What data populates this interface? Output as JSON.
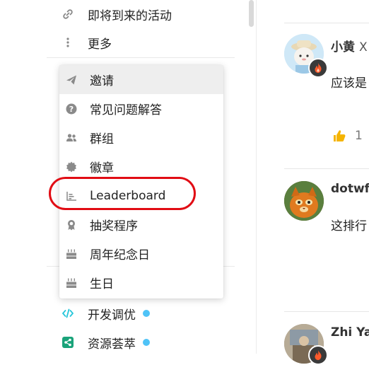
{
  "sidebar": {
    "items": [
      {
        "label": "即将到来的活动",
        "icon": "link-icon"
      },
      {
        "label": "更多",
        "icon": "vertical-ellipsis-icon"
      }
    ],
    "categories": [
      {
        "label": "开发调优",
        "icon": "code-icon",
        "dot_color": "#4fc3f7"
      },
      {
        "label": "资源荟萃",
        "icon": "share-icon",
        "dot_color": "#4fc3f7"
      }
    ]
  },
  "more_menu": {
    "items": [
      {
        "label": "邀请",
        "icon": "paper-plane-icon",
        "active": true
      },
      {
        "label": "常见问题解答",
        "icon": "question-circle-icon"
      },
      {
        "label": "群组",
        "icon": "users-icon"
      },
      {
        "label": "徽章",
        "icon": "badge-icon"
      },
      {
        "label": "Leaderboard",
        "icon": "bar-chart-icon",
        "highlighted": true
      },
      {
        "label": "抽奖程序",
        "icon": "award-icon"
      },
      {
        "label": "周年纪念日",
        "icon": "cake-icon"
      },
      {
        "label": "生日",
        "icon": "cake-icon"
      }
    ]
  },
  "posts": [
    {
      "author": "小黄",
      "author_suffix": "X",
      "text": "应该是",
      "likes": "1",
      "badge_icon": "flame-icon"
    },
    {
      "author": "dotwf",
      "text": "这排行"
    },
    {
      "author": "Zhi Ya",
      "badge_icon": "flame-icon"
    }
  ],
  "colors": {
    "highlight": "#e10c14",
    "thumb_up": "#f5b400",
    "flame": "#ff5a2b",
    "accent_dot": "#4fc3f7"
  }
}
